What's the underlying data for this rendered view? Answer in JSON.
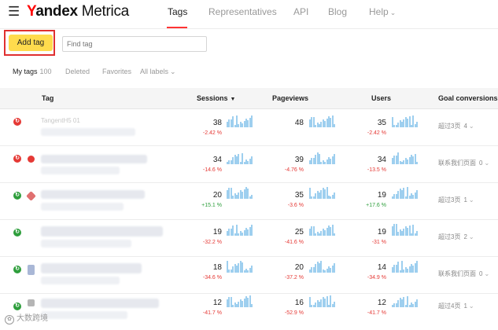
{
  "header": {
    "logo_first": "Y",
    "logo_rest": "andex",
    "logo_metrica": "Metrica",
    "nav": [
      "Tags",
      "Representatives",
      "API",
      "Blog",
      "Help"
    ],
    "active_nav": "Tags"
  },
  "toolbar": {
    "add_tag_label": "Add tag",
    "find_placeholder": "Find tag"
  },
  "filters": {
    "my_tags_label": "My tags",
    "my_tags_count": "100",
    "deleted_label": "Deleted",
    "favorites_label": "Favorites",
    "all_labels_label": "All labels"
  },
  "table": {
    "columns": {
      "tag": "Tag",
      "sessions": "Sessions",
      "pageviews": "Pageviews",
      "users": "Users",
      "goals": "Goal conversions"
    },
    "rows": [
      {
        "status": "red",
        "name": "TangentH5 01",
        "sessions": "38",
        "sessions_pct": "-2.42 %",
        "pageviews": "48",
        "pageviews_pct": "",
        "users": "35",
        "users_pct": "-2.42 %",
        "goal": "超过3页",
        "goal_count": "4"
      },
      {
        "status": "red",
        "name": "",
        "sessions": "34",
        "sessions_pct": "-14.6 %",
        "pageviews": "39",
        "pageviews_pct": "-4.76 %",
        "users": "34",
        "users_pct": "-13.5 %",
        "goal": "联系我们页面",
        "goal_count": "0"
      },
      {
        "status": "green",
        "name": "",
        "sessions": "20",
        "sessions_pct": "+15.1 %",
        "pageviews": "35",
        "pageviews_pct": "-3.6 %",
        "users": "19",
        "users_pct": "+17.6 %",
        "goal": "超过3页",
        "goal_count": "1"
      },
      {
        "status": "green",
        "name": "",
        "sessions": "19",
        "sessions_pct": "-32.2 %",
        "pageviews": "25",
        "pageviews_pct": "-41.6 %",
        "users": "19",
        "users_pct": "-31 %",
        "goal": "超过3页",
        "goal_count": "2"
      },
      {
        "status": "green",
        "name": "",
        "sessions": "18",
        "sessions_pct": "-34.6 %",
        "pageviews": "20",
        "pageviews_pct": "-37.2 %",
        "users": "14",
        "users_pct": "-34.9 %",
        "goal": "联系我们页面",
        "goal_count": "0"
      },
      {
        "status": "green",
        "name": "",
        "sessions": "12",
        "sessions_pct": "-41.7 %",
        "pageviews": "16",
        "pageviews_pct": "-52.9 %",
        "users": "12",
        "users_pct": "-41.7 %",
        "goal": "超过4页",
        "goal_count": "1"
      }
    ]
  },
  "colors": {
    "accent_yellow": "#ffdb4d",
    "highlight_red": "#e03030",
    "negative": "#e53935",
    "positive": "#2e9e3c",
    "spark": "#9ecfef"
  },
  "watermark": "大数跨境"
}
